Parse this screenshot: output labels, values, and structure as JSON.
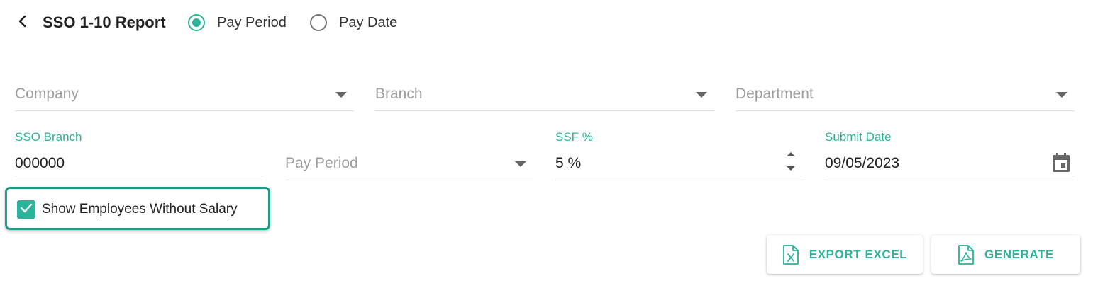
{
  "header": {
    "title": "SSO 1-10 Report",
    "radio_options": [
      {
        "label": "Pay Period",
        "checked": true
      },
      {
        "label": "Pay Date",
        "checked": false
      }
    ]
  },
  "filters": {
    "company": {
      "placeholder": "Company"
    },
    "branch": {
      "placeholder": "Branch"
    },
    "department": {
      "placeholder": "Department"
    }
  },
  "form": {
    "sso_branch": {
      "label": "SSO Branch",
      "value": "000000"
    },
    "pay_period": {
      "placeholder": "Pay Period"
    },
    "ssf_percent": {
      "label": "SSF %",
      "value": "5 %"
    },
    "submit_date": {
      "label": "Submit Date",
      "value": "09/05/2023"
    }
  },
  "options": {
    "show_without_salary": {
      "label": "Show Employees Without Salary",
      "checked": true
    }
  },
  "actions": {
    "export_excel": "EXPORT EXCEL",
    "generate": "GENERATE"
  },
  "colors": {
    "accent": "#2bb39b",
    "highlight_border": "#1f9c85",
    "text": "#222222",
    "placeholder": "#9e9e9e"
  },
  "icons": {
    "back": "chevron-left-icon",
    "calendar": "calendar-icon",
    "excel": "excel-file-icon",
    "pdf": "pdf-file-icon",
    "check": "check-icon"
  }
}
